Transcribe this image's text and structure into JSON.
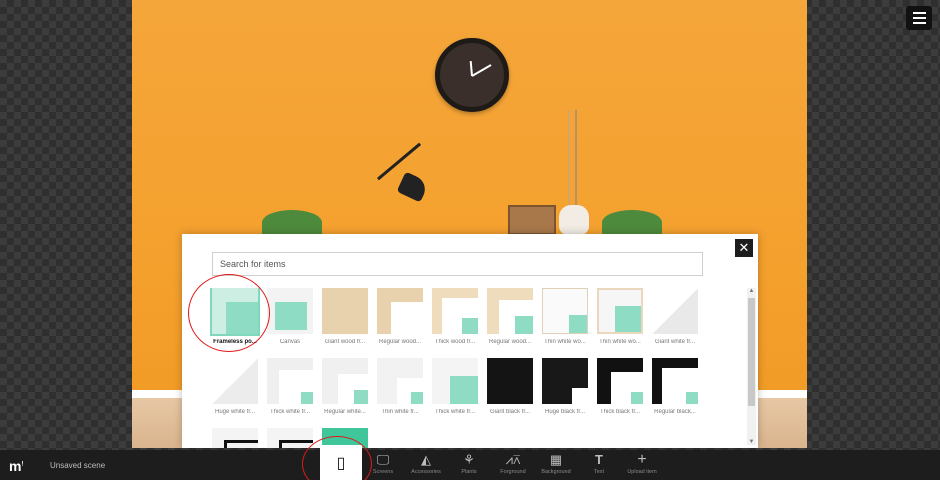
{
  "header": {
    "menu_icon": "hamburger-menu-icon"
  },
  "panel": {
    "search_placeholder": "Search for items",
    "close_icon": "close-icon",
    "items": [
      {
        "label": "Frameless po...",
        "selected": true
      },
      {
        "label": "Canvas"
      },
      {
        "label": "Giant wood fr..."
      },
      {
        "label": "Regular wood..."
      },
      {
        "label": "Thick wood fr..."
      },
      {
        "label": "Regular wood..."
      },
      {
        "label": "Thin white wo..."
      },
      {
        "label": "Thin white wo..."
      },
      {
        "label": "Giant white fr..."
      },
      {
        "label": "Huge white fr..."
      },
      {
        "label": "Thick white fr..."
      },
      {
        "label": "Regular white..."
      },
      {
        "label": "Thin white fr..."
      },
      {
        "label": "Thick white fr..."
      },
      {
        "label": "Giant black fr..."
      },
      {
        "label": "Huge black fr..."
      },
      {
        "label": "Thick black fr..."
      },
      {
        "label": "Regular black..."
      }
    ]
  },
  "bottombar": {
    "logo": "m",
    "scene_name": "Unsaved scene",
    "tools": [
      {
        "label": "",
        "icon": "frame-icon",
        "active": true
      },
      {
        "label": "Screens",
        "icon": "monitor-icon"
      },
      {
        "label": "Accessories",
        "icon": "accessories-icon"
      },
      {
        "label": "Plants",
        "icon": "plant-icon"
      },
      {
        "label": "Forground",
        "icon": "foreground-icon"
      },
      {
        "label": "Background",
        "icon": "background-icon"
      },
      {
        "label": "Text",
        "icon": "text-icon"
      },
      {
        "label": "Upload item",
        "icon": "plus-icon"
      }
    ]
  },
  "colors": {
    "accent": "#8fdcc4",
    "wall": "#f4a02d",
    "annotation": "#e01919",
    "bar": "#1d1d1d"
  }
}
